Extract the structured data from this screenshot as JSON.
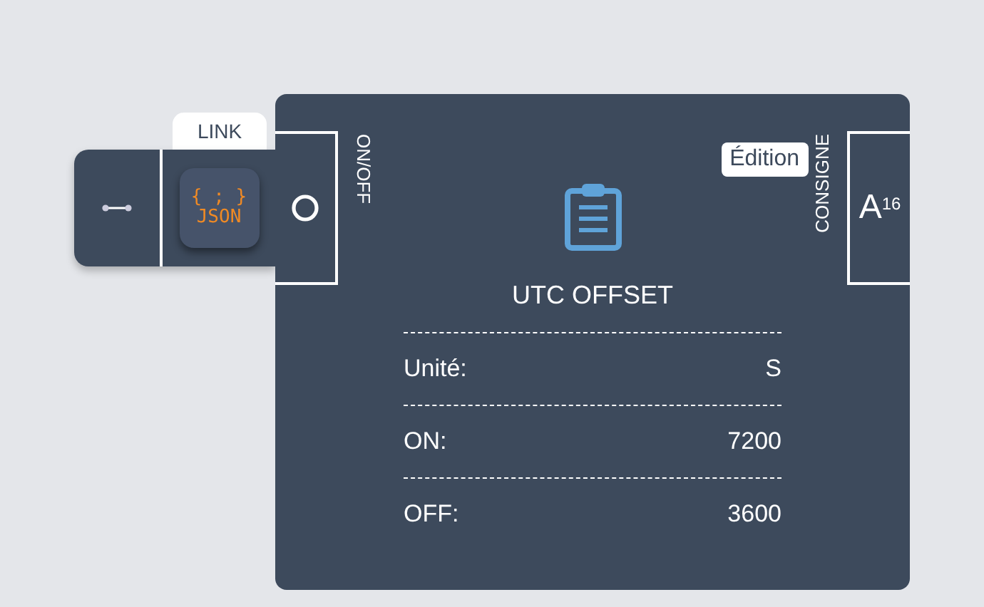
{
  "link_tab": {
    "label": "LINK"
  },
  "json_button": {
    "braces": "{ ; }",
    "label": "JSON"
  },
  "onoff": {
    "label": "ON/OFF"
  },
  "edit_badge": "Édition",
  "consigne": {
    "label": "CONSIGNE",
    "value": "A$^{16}$"
  },
  "title": "UTC OFFSET",
  "rows": [
    {
      "label": "Unité:",
      "value": "S"
    },
    {
      "label": "ON:",
      "value": "7200"
    },
    {
      "label": "OFF:",
      "value": "3600"
    }
  ]
}
